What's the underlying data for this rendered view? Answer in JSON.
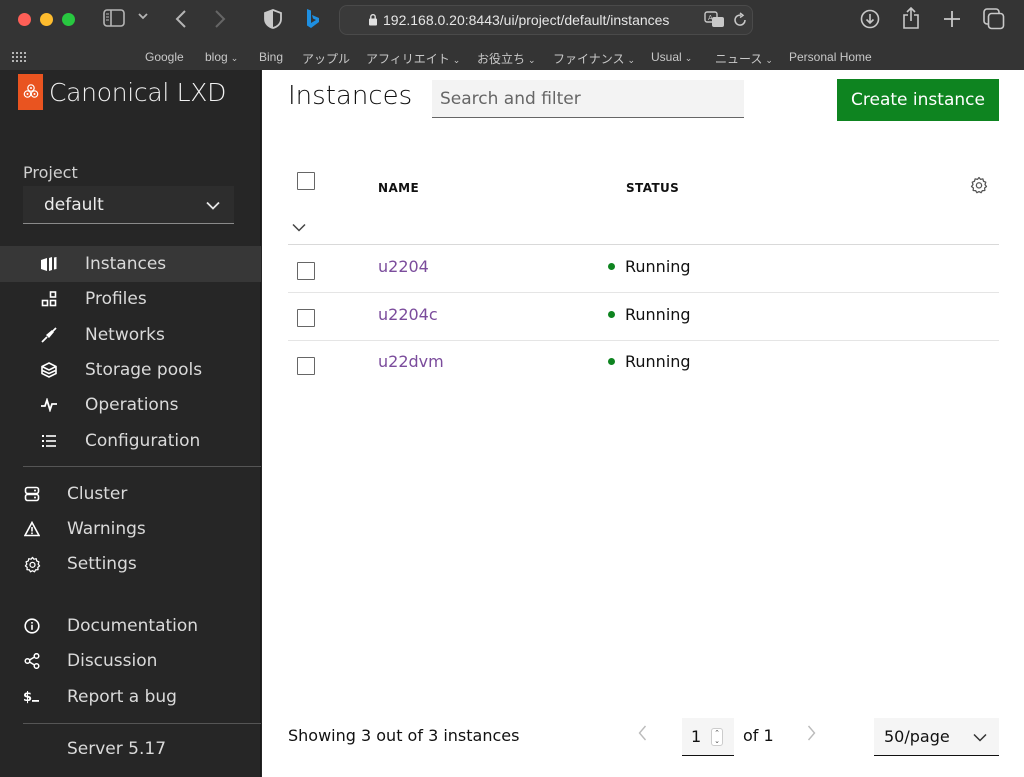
{
  "browser": {
    "url": "192.168.0.20:8443/ui/project/default/instances",
    "bookmarks": [
      {
        "label": "Google",
        "has_menu": false
      },
      {
        "label": "blog",
        "has_menu": true
      },
      {
        "label": "Bing",
        "has_menu": false
      },
      {
        "label": "アップル",
        "has_menu": false
      },
      {
        "label": "アフィリエイト",
        "has_menu": true
      },
      {
        "label": "お役立ち",
        "has_menu": true
      },
      {
        "label": "ファイナンス",
        "has_menu": true
      },
      {
        "label": "Usual",
        "has_menu": true
      },
      {
        "label": "ニュース",
        "has_menu": true
      },
      {
        "label": "Personal Home",
        "has_menu": false
      }
    ]
  },
  "sidebar": {
    "brand": "Canonical LXD",
    "project_label": "Project",
    "project_value": "default",
    "project_items": [
      {
        "label": "Instances",
        "icon": "instances-icon",
        "active": true
      },
      {
        "label": "Profiles",
        "icon": "profiles-icon",
        "active": false
      },
      {
        "label": "Networks",
        "icon": "networks-icon",
        "active": false
      },
      {
        "label": "Storage pools",
        "icon": "storage-icon",
        "active": false
      },
      {
        "label": "Operations",
        "icon": "operations-icon",
        "active": false
      },
      {
        "label": "Configuration",
        "icon": "configuration-icon",
        "active": false
      }
    ],
    "global_items": [
      {
        "label": "Cluster",
        "icon": "cluster-icon"
      },
      {
        "label": "Warnings",
        "icon": "warning-icon"
      },
      {
        "label": "Settings",
        "icon": "gear-icon"
      }
    ],
    "help_items": [
      {
        "label": "Documentation",
        "icon": "info-icon"
      },
      {
        "label": "Discussion",
        "icon": "share-icon"
      },
      {
        "label": "Report a bug",
        "icon": "terminal-icon"
      }
    ],
    "server_version": "Server 5.17"
  },
  "main": {
    "title": "Instances",
    "search_placeholder": "Search and filter",
    "create_button": "Create instance",
    "columns": [
      "NAME",
      "STATUS"
    ],
    "instances": [
      {
        "name": "u2204",
        "status": "Running"
      },
      {
        "name": "u2204c",
        "status": "Running"
      },
      {
        "name": "u22dvm",
        "status": "Running"
      }
    ],
    "footer": {
      "showing": "Showing 3 out of 3 instances",
      "page": "1",
      "of": "of 1",
      "per_page": "50/page"
    }
  },
  "colors": {
    "brand": "#e95420",
    "primary_button": "#0e8420",
    "running": "#0e8420",
    "link": "#7b4c9c"
  }
}
